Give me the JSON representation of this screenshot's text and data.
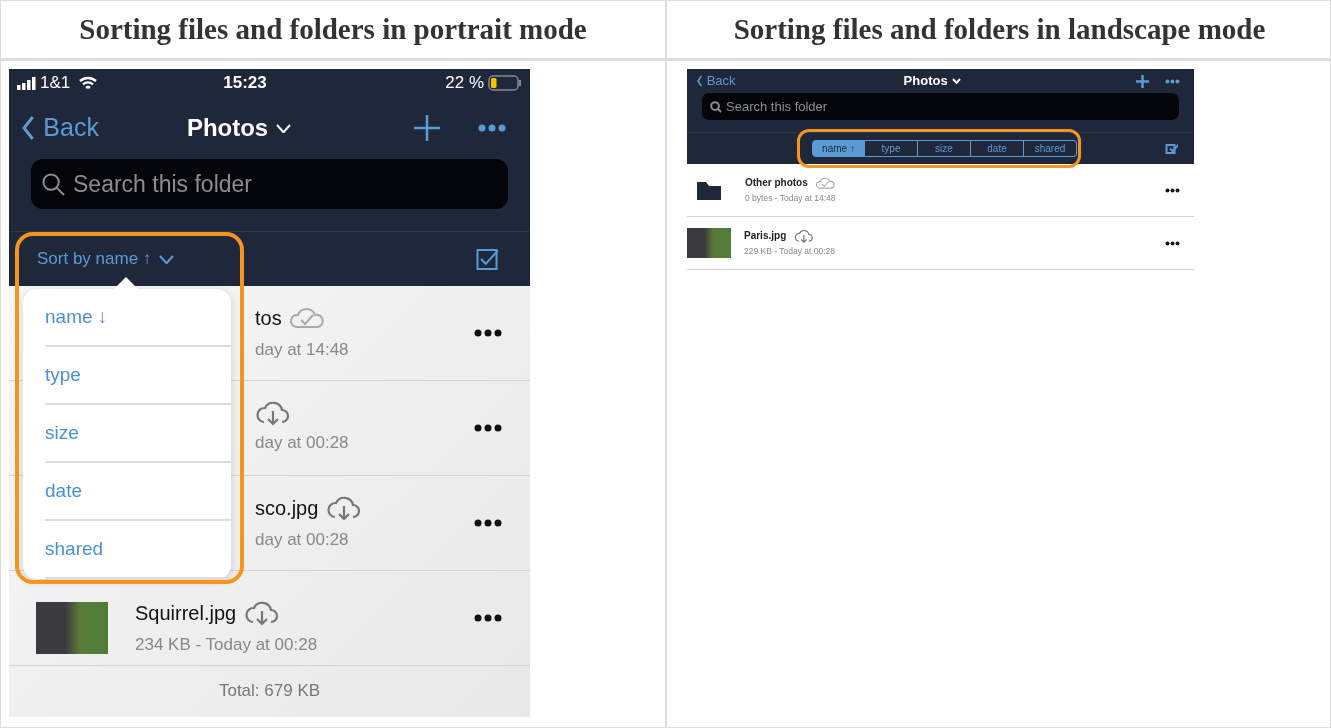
{
  "columns": [
    {
      "heading": "Sorting files and folders in portrait mode"
    },
    {
      "heading": "Sorting files and folders in landscape mode"
    }
  ],
  "portrait": {
    "status_bar": {
      "carrier": "1&1",
      "time": "15:23",
      "battery": "22 %"
    },
    "nav": {
      "back": "Back",
      "title": "Photos"
    },
    "search": {
      "placeholder": "Search this folder"
    },
    "sort_button": {
      "label": "Sort by name ↑",
      "highlighted": true
    },
    "sort_menu": [
      {
        "label": "name ↓"
      },
      {
        "label": "type"
      },
      {
        "label": "size"
      },
      {
        "label": "date"
      },
      {
        "label": "shared"
      }
    ],
    "files": [
      {
        "kind": "folder",
        "name": "tos",
        "meta": "day at 14:48",
        "obscured": true
      },
      {
        "kind": "photo",
        "meta": "day at 00:28",
        "obscured": true
      },
      {
        "kind": "photo",
        "name": "sco.jpg",
        "meta": "day at 00:28",
        "obscured": true
      },
      {
        "kind": "photo",
        "name": "Squirrel.jpg",
        "meta": "234 KB - Today at 00:28",
        "obscured": false
      }
    ],
    "total": "Total: 679 KB"
  },
  "landscape": {
    "nav": {
      "back": "Back",
      "title": "Photos"
    },
    "search": {
      "placeholder": "Search this folder"
    },
    "sort_highlighted": true,
    "sort_segments": [
      {
        "label": "name ↑",
        "selected": true
      },
      {
        "label": "type",
        "selected": false
      },
      {
        "label": "size",
        "selected": false
      },
      {
        "label": "date",
        "selected": false
      },
      {
        "label": "shared",
        "selected": false
      }
    ],
    "files": [
      {
        "kind": "folder",
        "name": "Other photos",
        "meta": "0 bytes - Today at 14:48"
      },
      {
        "kind": "photo",
        "name": "Paris.jpg",
        "meta": "229 KB - Today at 00:28"
      }
    ]
  }
}
